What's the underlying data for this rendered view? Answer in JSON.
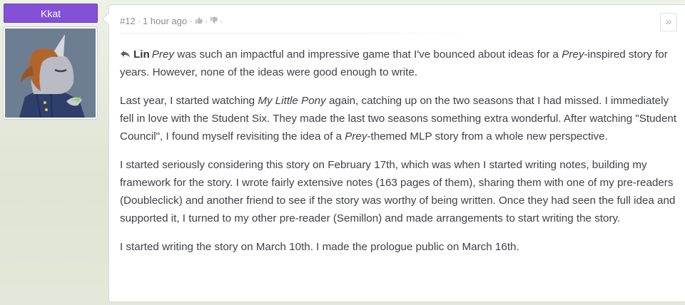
{
  "author": {
    "name": "Kkat"
  },
  "comment": {
    "number": "#12",
    "time": "1 hour ago",
    "reply_to": "Lin",
    "paragraphs": [
      [
        {
          "t": "Prey",
          "i": true
        },
        {
          "t": " was such an impactful and impressive game that I've bounced about ideas for a "
        },
        {
          "t": "Prey",
          "i": true
        },
        {
          "t": "-inspired story for years. However, none of the ideas were good enough to write."
        }
      ],
      [
        {
          "t": "Last year, I started watching "
        },
        {
          "t": "My Little Pony",
          "i": true
        },
        {
          "t": " again, catching up on the two seasons that I had missed. I immediately fell in love with the Student Six. They made the last two seasons something extra wonderful. After watching \"Student Council\", I found myself revisiting the idea of a "
        },
        {
          "t": "Prey",
          "i": true
        },
        {
          "t": "-themed MLP story from a whole new perspective."
        }
      ],
      [
        {
          "t": "I started seriously considering this story on February 17th, which was when I started writing notes, building my framework for the story. I wrote fairly extensive notes (163 pages of them), sharing them with one of my pre-readers (Doubleclick) and another friend to see if the story was worthy of being written. Once they had seen the full idea and supported it, I turned to my other pre-reader (Semillon) and made arrangements to start writing the story."
        }
      ],
      [
        {
          "t": "I started writing the story on March 10th. I made the prologue public on March 16th."
        }
      ]
    ]
  },
  "icons": {
    "thumbs_up": "thumbs-up-icon",
    "thumbs_down": "thumbs-down-icon",
    "reply": "reply-icon",
    "expand": "double-chevron-right-icon"
  },
  "colors": {
    "author_badge": "#8350d6",
    "text": "#3e4148",
    "meta": "#888d96"
  }
}
